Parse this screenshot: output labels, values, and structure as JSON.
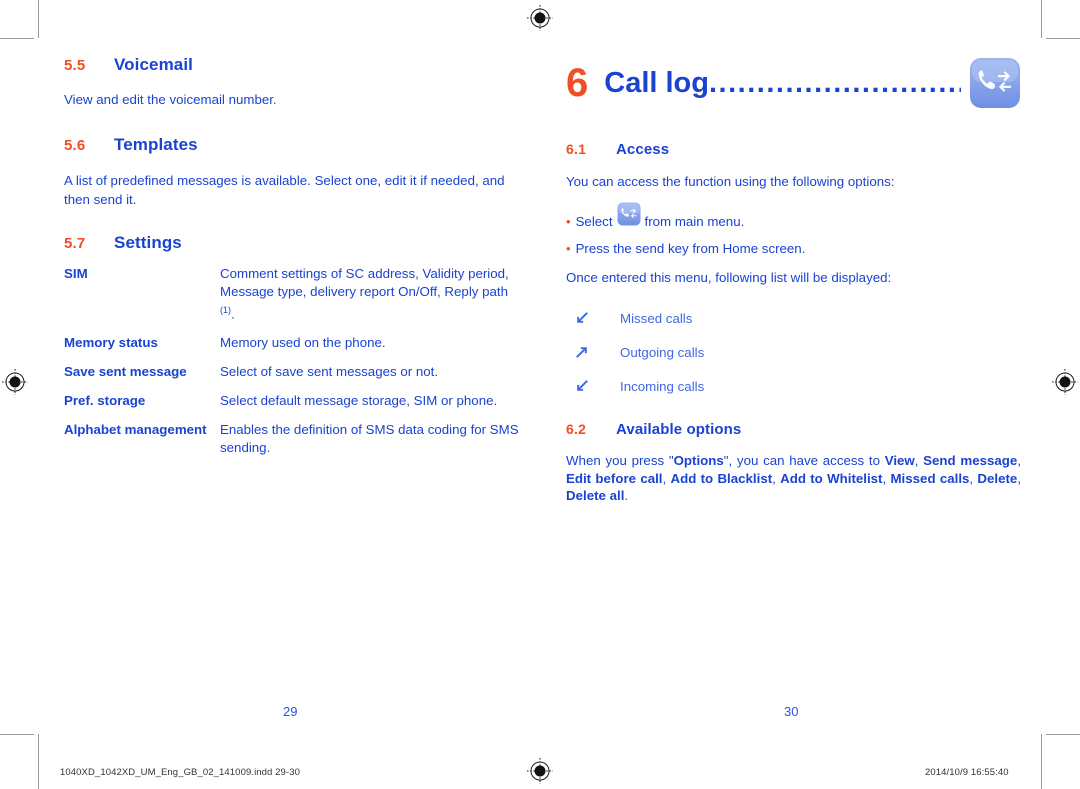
{
  "document": {
    "left_page": {
      "page_number": "29",
      "sections": [
        {
          "number": "5.5",
          "title": "Voicemail",
          "body": "View and edit the voicemail number."
        },
        {
          "number": "5.6",
          "title": "Templates",
          "body": "A list of predefined messages is available. Select one, edit it if needed, and then send it."
        },
        {
          "number": "5.7",
          "title": "Settings"
        }
      ],
      "settings_table": [
        {
          "term": "SIM",
          "description": "Comment settings of  SC address, Validity period, Message type, delivery report On/Off, Reply path ",
          "footnote": "(1)",
          "description_tail": "."
        },
        {
          "term": "Memory status",
          "description": "Memory used on the phone."
        },
        {
          "term": "Save sent message",
          "description": "Select of save sent messages or not."
        },
        {
          "term": "Pref. storage",
          "description": "Select default message storage, SIM or phone."
        },
        {
          "term": "Alphabet management",
          "description": "Enables the definition of SMS data coding for SMS sending."
        }
      ]
    },
    "right_page": {
      "page_number": "30",
      "chapter": {
        "number": "6",
        "title": "Call log",
        "dots": "...............................................",
        "icon": "call-log-icon"
      },
      "sections": [
        {
          "number": "6.1",
          "title": "Access",
          "intro": "You can access the function using the following options:",
          "bullets": [
            {
              "prefix": "Select",
              "icon": "call-log-icon",
              "suffix": "from main menu."
            },
            {
              "text": "Press the send key from Home screen."
            }
          ],
          "outro": "Once entered this menu, following list will be displayed:",
          "call_list": [
            {
              "icon": "arrow-down-left-icon",
              "label": "Missed calls"
            },
            {
              "icon": "arrow-up-right-icon",
              "label": "Outgoing calls"
            },
            {
              "icon": "arrow-down-left-icon",
              "label": "Incoming calls"
            }
          ]
        },
        {
          "number": "6.2",
          "title": "Available options",
          "paragraph_parts": [
            {
              "text": "When you press \"",
              "bold": false
            },
            {
              "text": "Options",
              "bold": true
            },
            {
              "text": "\", you can have access to ",
              "bold": false
            },
            {
              "text": "View",
              "bold": true
            },
            {
              "text": ", ",
              "bold": false
            },
            {
              "text": "Send message",
              "bold": true
            },
            {
              "text": ", ",
              "bold": false
            },
            {
              "text": "Edit before call",
              "bold": true
            },
            {
              "text": ", ",
              "bold": false
            },
            {
              "text": "Add to Blacklist",
              "bold": true
            },
            {
              "text": ", ",
              "bold": false
            },
            {
              "text": "Add to Whitelist",
              "bold": true
            },
            {
              "text": ", ",
              "bold": false
            },
            {
              "text": "Missed calls",
              "bold": true
            },
            {
              "text": ", ",
              "bold": false
            },
            {
              "text": "Delete",
              "bold": true
            },
            {
              "text": ", ",
              "bold": false
            },
            {
              "text": "Delete all",
              "bold": true
            },
            {
              "text": ".",
              "bold": false
            }
          ]
        }
      ]
    },
    "footer": {
      "filename": "1040XD_1042XD_UM_Eng_GB_02_141009.indd   29-30",
      "timestamp": "2014/10/9   16:55:40"
    },
    "colors": {
      "accent_orange": "#F04E23",
      "heading_blue": "#1A43D2",
      "body_blue": "#2A52E8",
      "icon_blue": "#7B9BE8"
    }
  }
}
